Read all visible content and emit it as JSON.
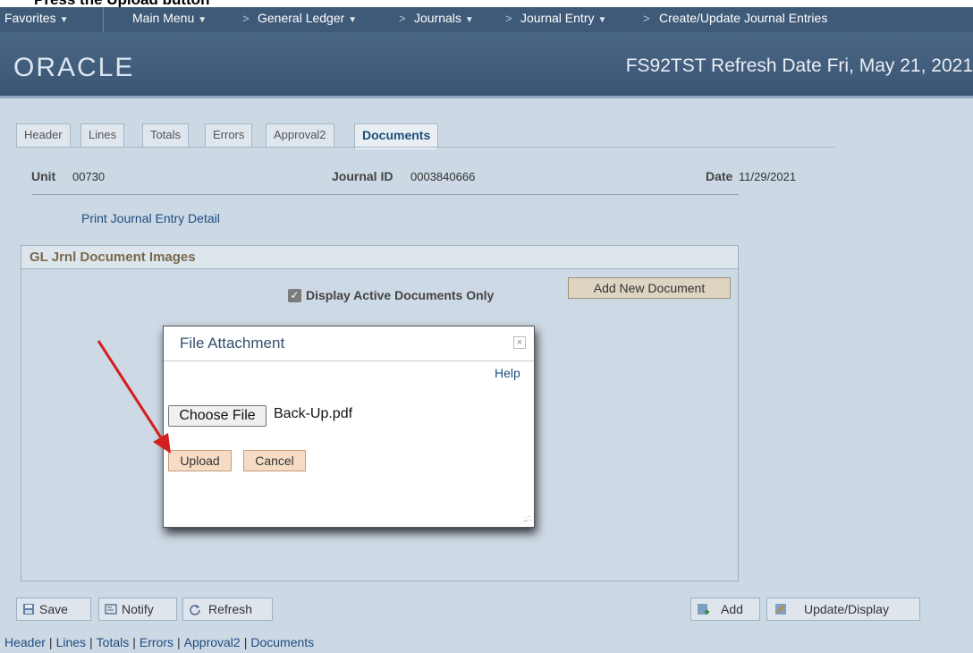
{
  "top_clip_text": "Press the Upload button",
  "nav": {
    "favorites": "Favorites",
    "main_menu": "Main Menu",
    "crumbs": [
      "General Ledger",
      "Journals",
      "Journal Entry",
      "Create/Update Journal Entries"
    ]
  },
  "brand": {
    "logo": "ORACLE",
    "environment": "FS92TST Refresh Date Fri, May 21, 2021"
  },
  "tabs": [
    "Header",
    "Lines",
    "Totals",
    "Errors",
    "Approval2",
    "Documents"
  ],
  "active_tab": "Documents",
  "fields": {
    "unit_label": "Unit",
    "unit_value": "00730",
    "journal_id_label": "Journal ID",
    "journal_id_value": "0003840666",
    "date_label": "Date",
    "date_value": "11/29/2021"
  },
  "print_link": "Print Journal Entry Detail",
  "group": {
    "title": "GL Jrnl Document Images",
    "checkbox_label": "Display Active Documents Only",
    "checkbox_checked": true,
    "add_button": "Add New Document"
  },
  "dialog": {
    "title": "File Attachment",
    "close": "×",
    "help": "Help",
    "choose_file": "Choose File",
    "file_name": "Back-Up.pdf",
    "upload": "Upload",
    "cancel": "Cancel"
  },
  "toolbar": {
    "save": "Save",
    "notify": "Notify",
    "refresh": "Refresh",
    "add": "Add",
    "update_display": "Update/Display"
  },
  "footer_links": [
    "Header",
    "Lines",
    "Totals",
    "Errors",
    "Approval2",
    "Documents"
  ],
  "colors": {
    "nav_bg": "#3f5a78",
    "brand_bg": "#4b6786",
    "content_bg": "#ccd8e4",
    "arrow": "#d21f1f",
    "upload_btn": "#f6dcc4"
  }
}
